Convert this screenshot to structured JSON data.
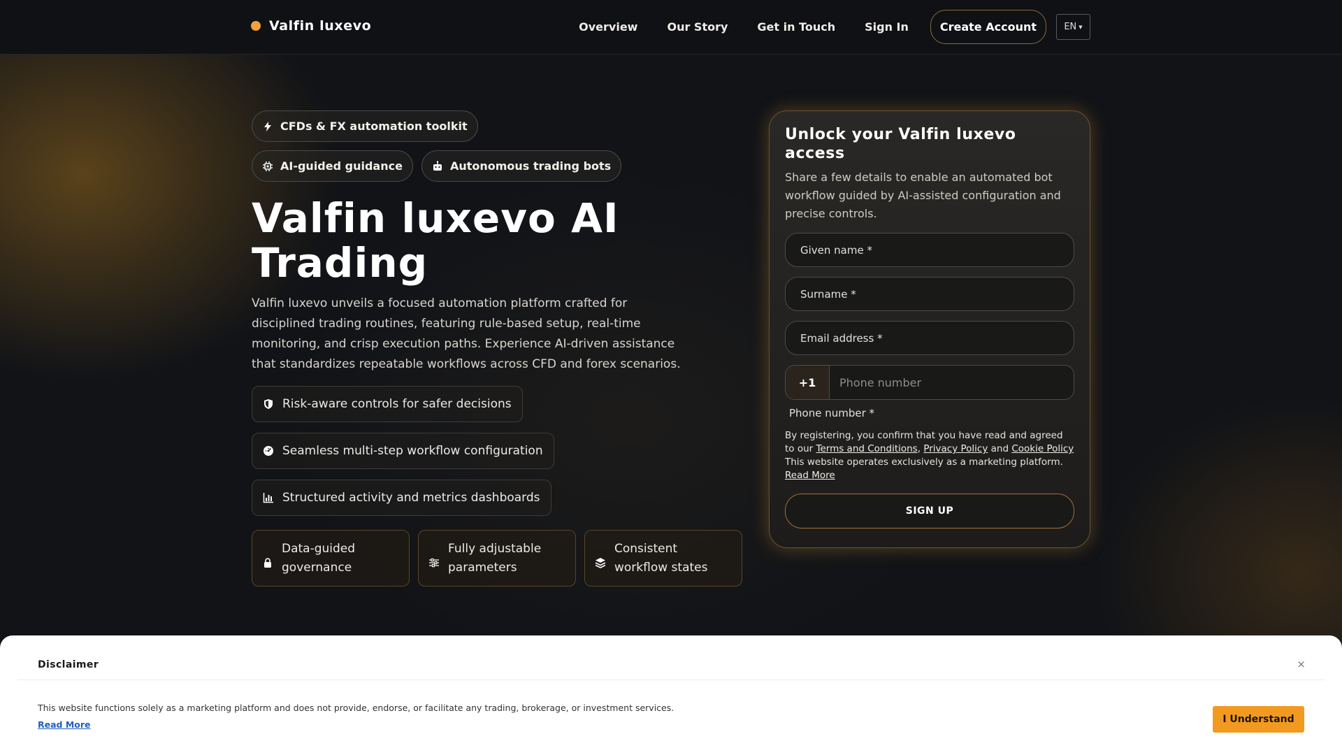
{
  "brand": {
    "name": "Valfin luxevo"
  },
  "nav": {
    "items": [
      "Overview",
      "Our Story",
      "Get in Touch",
      "Sign In"
    ],
    "create_account": "Create Account",
    "language": "EN"
  },
  "hero": {
    "pills": [
      {
        "label": "CFDs & FX automation toolkit",
        "icon": "bolt-icon"
      },
      {
        "label": "AI-guided guidance",
        "icon": "chip-icon"
      },
      {
        "label": "Autonomous trading bots",
        "icon": "robot-icon"
      }
    ],
    "title": "Valfin luxevo AI Trading",
    "description": "Valfin luxevo unveils a focused automation platform crafted for disciplined trading routines, featuring rule-based setup, real-time monitoring, and crisp execution paths. Experience AI-driven assistance that standardizes repeatable workflows across CFD and forex scenarios.",
    "features": [
      {
        "label": "Risk-aware controls for safer decisions",
        "icon": "shield-icon"
      },
      {
        "label": "Seamless multi-step workflow configuration",
        "icon": "dashboard-icon"
      },
      {
        "label": "Structured activity and metrics dashboards",
        "icon": "bar-chart-icon"
      }
    ],
    "cards": [
      {
        "label": "Data-guided governance",
        "icon": "lock-icon"
      },
      {
        "label": "Fully adjustable parameters",
        "icon": "sliders-icon"
      },
      {
        "label": "Consistent workflow states",
        "icon": "layers-icon"
      }
    ]
  },
  "form": {
    "title": "Unlock your Valfin luxevo access",
    "subtitle": "Share a few details to enable an automated bot workflow guided by AI-assisted configuration and precise controls.",
    "given_name": "Given name *",
    "surname": "Surname *",
    "email": "Email address *",
    "phone_code": "+1",
    "phone_placeholder": "Phone number",
    "phone_label": "Phone number *",
    "consent_prefix": "By registering, you confirm that you have read and agreed to our",
    "terms": "Terms and Conditions",
    "privacy": "Privacy Policy",
    "and": "and",
    "cookie": "Cookie Policy",
    "consent_suffix": "This website operates exclusively as a marketing platform.",
    "read_more": "Read More",
    "signup": "SIGN UP"
  },
  "disclaimer": {
    "title": "Disclaimer",
    "close": "×",
    "text": "This website functions solely as a marketing platform and does not provide, endorse, or facilitate any trading, brokerage, or investment services.",
    "read_more": "Read More",
    "button": "I Understand"
  },
  "colors": {
    "accent": "#f29a20",
    "brand_dot": "#f2a03a",
    "background": "#111317"
  }
}
